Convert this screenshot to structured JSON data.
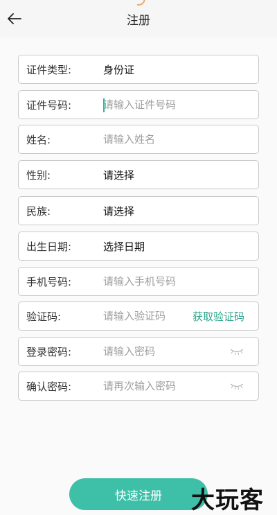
{
  "header": {
    "title": "注册",
    "back_icon": "arrow-left-icon"
  },
  "fields": [
    {
      "label": "证件类型:",
      "value": "身份证"
    },
    {
      "label": "证件号码:",
      "placeholder": "请输入证件号码"
    },
    {
      "label": "姓名:",
      "placeholder": "请输入姓名"
    },
    {
      "label": "性别:",
      "value": "请选择"
    },
    {
      "label": "民族:",
      "value": "请选择"
    },
    {
      "label": "出生日期:",
      "value": "选择日期"
    },
    {
      "label": "手机号码:",
      "placeholder": "请输入手机号码"
    },
    {
      "label": "验证码:",
      "placeholder": "请输入验证码",
      "action": "获取验证码"
    },
    {
      "label": "登录密码:",
      "placeholder": "请输入密码",
      "icon": "eye-closed-icon"
    },
    {
      "label": "确认密码:",
      "placeholder": "请再次输入密码",
      "icon": "eye-closed-icon"
    }
  ],
  "submit_label": "快速注册",
  "watermark": "大玩客",
  "colors": {
    "accent": "#3dbfa8",
    "accent_text": "#2aa58b",
    "placeholder": "#9e9e9e"
  }
}
